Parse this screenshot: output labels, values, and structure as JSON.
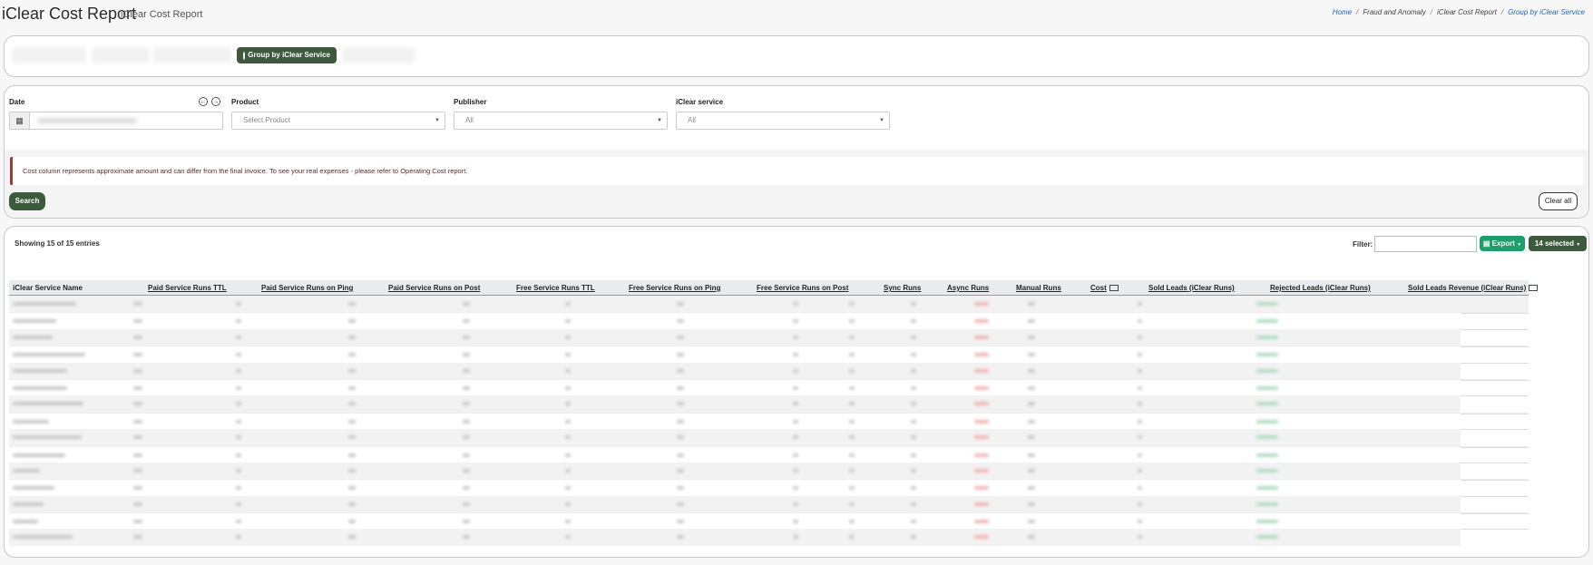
{
  "header": {
    "title": "iClear Cost Report",
    "subtitle": "iClear Cost Report",
    "breadcrumb": [
      "Home",
      "Fraud and Anomaly",
      "iClear Cost Report",
      "Group by iClear Service"
    ]
  },
  "tabs": {
    "active_label": "Group by iClear Service"
  },
  "filters": {
    "date_label": "Date",
    "product_label": "Product",
    "product_placeholder": "Select Product",
    "publisher_label": "Publisher",
    "publisher_value": "All",
    "service_label": "iClear service",
    "service_value": "All"
  },
  "notice": "Cost column represents approximate amount and can differ from the final invoice. To see your real expenses - please refer to Operating Cost report.",
  "buttons": {
    "search": "Search",
    "clear_all": "Clear all",
    "export": "Export",
    "selected": "14 selected"
  },
  "table": {
    "entries_text": "Showing 15 of 15 entries",
    "filter_label": "Filter:",
    "columns": [
      "iClear Service Name",
      "Paid Service Runs TTL",
      "Paid Service Runs on Ping",
      "Paid Service Runs on Post",
      "Free Service Runs TTL",
      "Free Service Runs on Ping",
      "Free Service Runs on Post",
      "Sync Runs",
      "Async Runs",
      "Manual Runs",
      "Cost",
      "Sold Leads (iClear Runs)",
      "Rejected Leads (iClear Runs)",
      "Sold Leads Revenue (iClear Runs)"
    ],
    "row_count": 15
  },
  "colors": {
    "primary_dark_green": "#3d5a3d",
    "export_green": "#1d9e6a",
    "link_blue": "#1e62c9",
    "notice_border": "#a33333"
  }
}
